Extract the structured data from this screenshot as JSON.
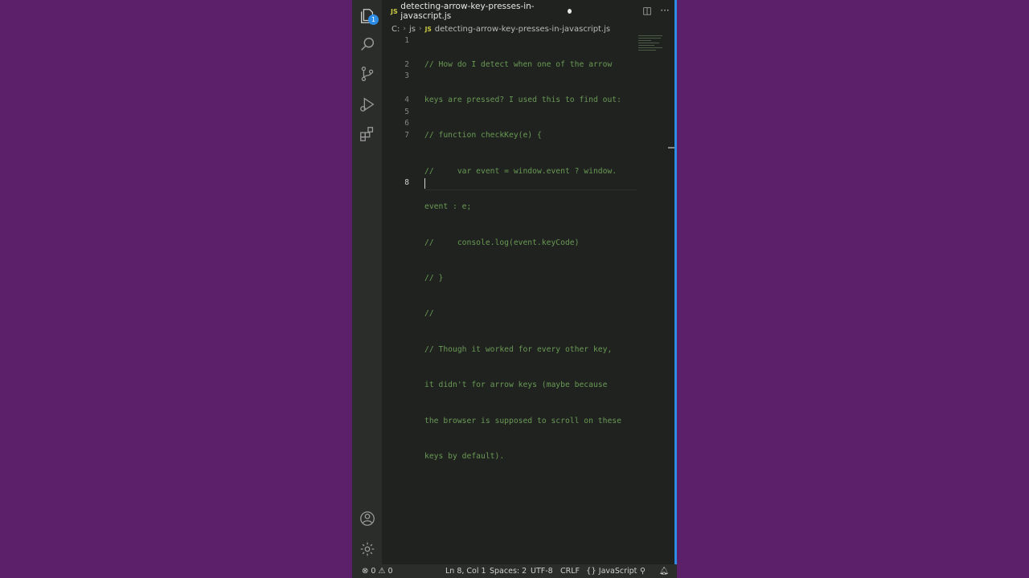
{
  "tab": {
    "js_label": "JS",
    "title": "detecting-arrow-key-presses-in-javascript.js"
  },
  "activity_bar": {
    "explorer_badge": "1"
  },
  "breadcrumb": {
    "drive": "C:",
    "folder": "js",
    "js_label": "JS",
    "file": "detecting-arrow-key-presses-in-javascript.js"
  },
  "editor": {
    "line_numbers": [
      "1",
      "2",
      "3",
      "4",
      "5",
      "6",
      "7",
      "8"
    ],
    "visual_lines": [
      "// How do I detect when one of the arrow",
      "keys are pressed? I used this to find out:",
      "// function checkKey(e) {",
      "//     var event = window.event ? window.",
      "event : e;",
      "//     console.log(event.keyCode)",
      "// }",
      "//",
      "// Though it worked for every other key,",
      "it didn't for arrow keys (maybe because",
      "the browser is supposed to scroll on these",
      "keys by default).",
      ""
    ]
  },
  "status_bar": {
    "errors": "0",
    "warnings": "0",
    "position": "Ln 8, Col 1",
    "spaces": "Spaces: 2",
    "encoding": "UTF-8",
    "eol": "CRLF",
    "language": "JavaScript"
  },
  "colors": {
    "background": "#5c206b",
    "editor_bg": "#1f221f",
    "comment": "#6a9955",
    "accent": "#2c8ce6"
  }
}
